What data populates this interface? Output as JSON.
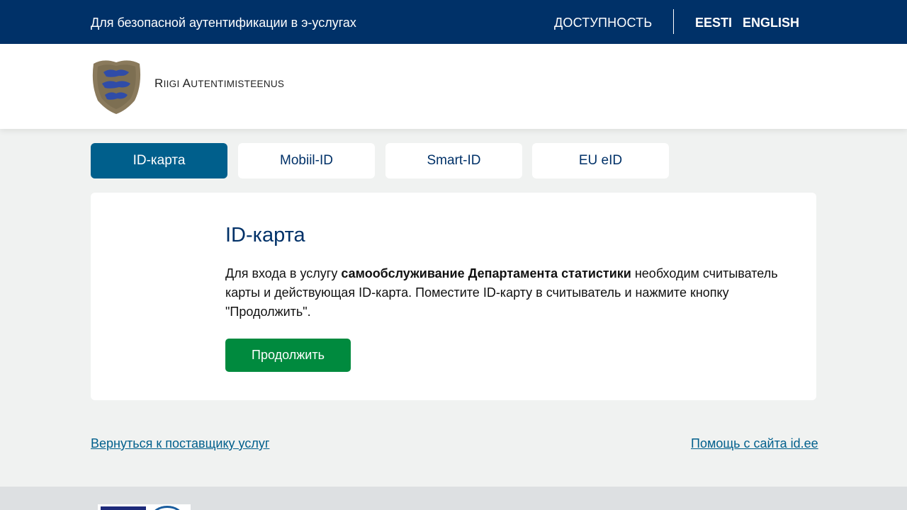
{
  "topbar": {
    "tagline": "Для безопасной аутентификации в э-услугах",
    "accessibility": "ДОСТУПНОСТЬ",
    "languages": [
      "EESTI",
      "ENGLISH"
    ]
  },
  "header": {
    "brand_first": "R",
    "brand_rest_1": "IIGI ",
    "brand_second": "A",
    "brand_rest_2": "UTENTIMISTEENUS"
  },
  "tabs": [
    "ID-карта",
    "Mobiil-ID",
    "Smart-ID",
    "EU eID"
  ],
  "active_tab": "ID-карта",
  "card": {
    "title": "ID-карта",
    "text_before": "Для входа в услугу ",
    "text_bold": "самообслуживание Департамента статистики",
    "text_after": " необходим считыватель карты и действующая ID-карта. Поместите ID-карту в считыватель и нажмите кнопку \"Продолжить\".",
    "button": "Продолжить"
  },
  "links": {
    "back": "Вернуться к поставщику услуг",
    "help": "Помощь с сайта id.ee"
  },
  "colors": {
    "topbar": "#003168",
    "active_tab": "#005f8c",
    "button": "#008a3e",
    "link": "#005f8c"
  }
}
